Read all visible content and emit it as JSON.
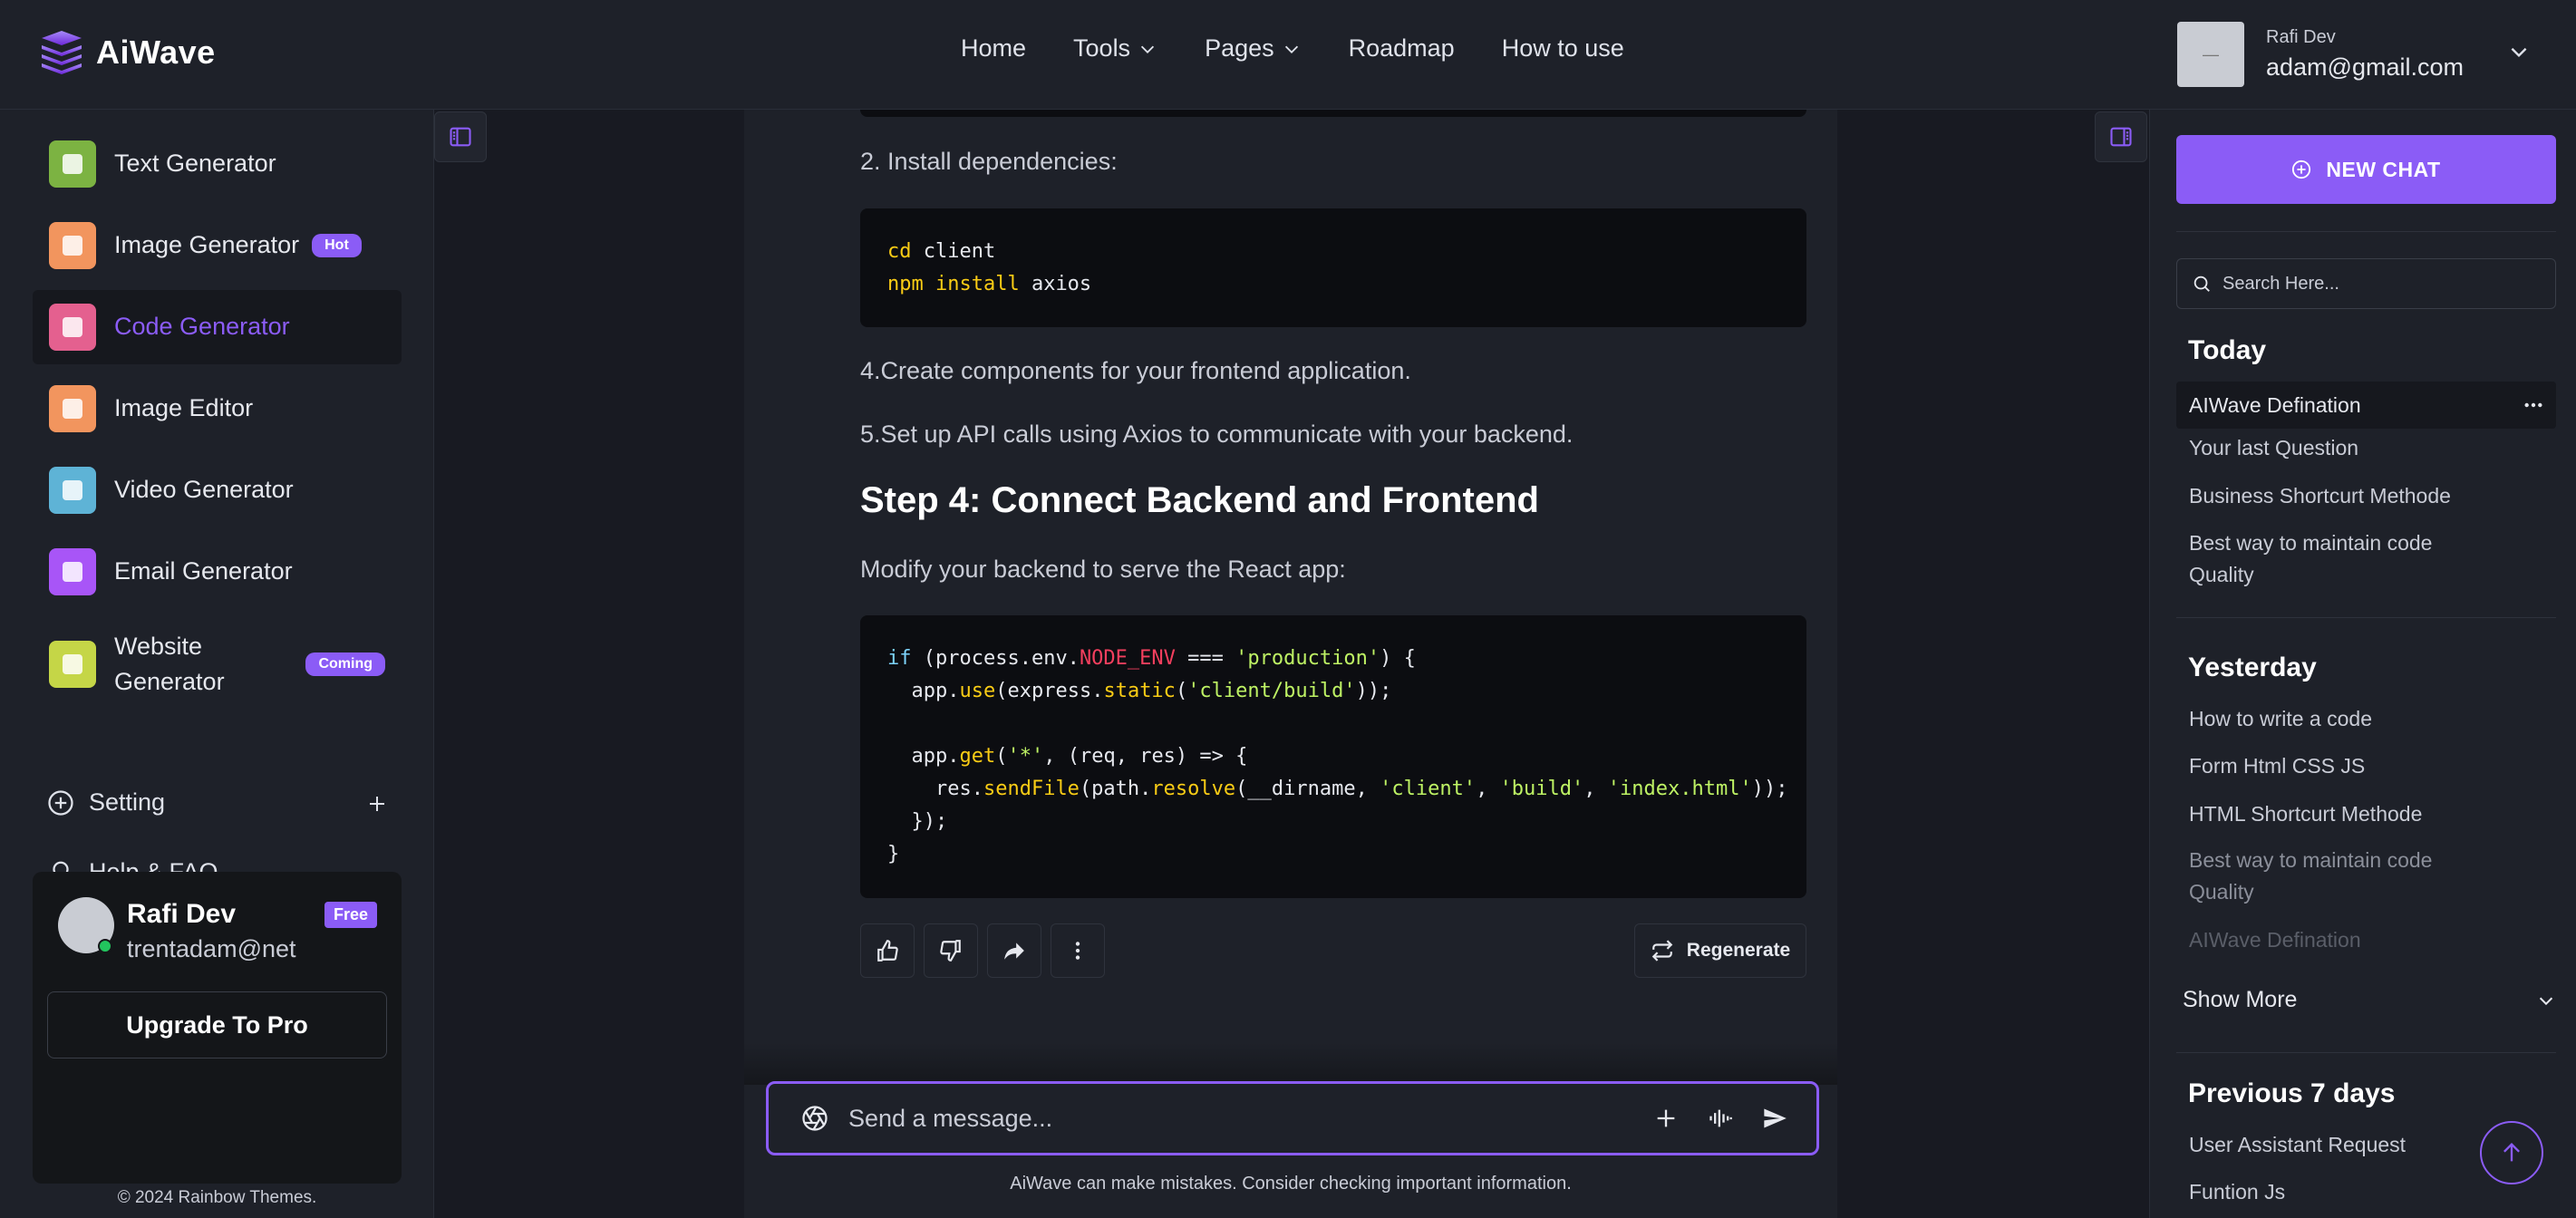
{
  "app": {
    "name": "AiWave"
  },
  "nav": {
    "items": [
      {
        "label": "Home",
        "has_dropdown": false
      },
      {
        "label": "Tools",
        "has_dropdown": true
      },
      {
        "label": "Pages",
        "has_dropdown": true
      },
      {
        "label": "Roadmap",
        "has_dropdown": false
      },
      {
        "label": "How to use",
        "has_dropdown": false
      }
    ]
  },
  "user": {
    "name": "Rafi Dev",
    "email": "adam@gmail.com",
    "avatar_text": "—"
  },
  "sidebar": {
    "items": [
      {
        "label": "Text Generator",
        "icon": "text-doc-icon",
        "color": "#7cb342"
      },
      {
        "label": "Image Generator",
        "icon": "image-icon",
        "color": "#f2955e",
        "badge": "Hot"
      },
      {
        "label": "Code Generator",
        "icon": "code-icon",
        "color": "#e4608f",
        "active": true
      },
      {
        "label": "Image Editor",
        "icon": "image-edit-icon",
        "color": "#f2955e"
      },
      {
        "label": "Video Generator",
        "icon": "video-icon",
        "color": "#5eb3d6"
      },
      {
        "label": "Email Generator",
        "icon": "email-icon",
        "color": "#a855f7"
      },
      {
        "label": "Website Generator",
        "icon": "website-icon",
        "color": "#c5d647",
        "badge": "Coming"
      }
    ],
    "setting_label": "Setting",
    "help_label": "Help & FAQ"
  },
  "profile_card": {
    "name": "Rafi Dev",
    "email": "trentadam@net",
    "plan": "Free",
    "upgrade_label": "Upgrade To Pro"
  },
  "copyright": "© 2024 Rainbow Themes.",
  "chat": {
    "step_install": "2. Install dependencies:",
    "code1": [
      [
        {
          "t": "cd",
          "c": "yl"
        },
        {
          "t": " client",
          "c": ""
        }
      ],
      [
        {
          "t": "npm install",
          "c": "yl"
        },
        {
          "t": " axios",
          "c": ""
        }
      ]
    ],
    "step_components": "4.Create components for your frontend application.",
    "step_api": "5.Set up API calls using Axios to communicate with your backend.",
    "heading": "Step 4: Connect Backend and Frontend",
    "modify_text": "Modify your backend to serve the React app:",
    "code2": [
      [
        {
          "t": "if",
          "c": "kw"
        },
        {
          "t": " (process.env.",
          "c": ""
        },
        {
          "t": "NODE_ENV",
          "c": "env"
        },
        {
          "t": " === ",
          "c": ""
        },
        {
          "t": "'production'",
          "c": "str"
        },
        {
          "t": ") {",
          "c": ""
        }
      ],
      [
        {
          "t": "  app.",
          "c": ""
        },
        {
          "t": "use",
          "c": "fn"
        },
        {
          "t": "(express.",
          "c": ""
        },
        {
          "t": "static",
          "c": "fn"
        },
        {
          "t": "(",
          "c": ""
        },
        {
          "t": "'client/build'",
          "c": "str"
        },
        {
          "t": "));",
          "c": ""
        }
      ],
      [
        {
          "t": "",
          "c": ""
        }
      ],
      [
        {
          "t": "  app.",
          "c": ""
        },
        {
          "t": "get",
          "c": "fn"
        },
        {
          "t": "(",
          "c": ""
        },
        {
          "t": "'*'",
          "c": "str"
        },
        {
          "t": ", (req, res) => {",
          "c": ""
        }
      ],
      [
        {
          "t": "    res.",
          "c": ""
        },
        {
          "t": "sendFile",
          "c": "fn"
        },
        {
          "t": "(path.",
          "c": ""
        },
        {
          "t": "resolve",
          "c": "fn"
        },
        {
          "t": "(__dirname, ",
          "c": ""
        },
        {
          "t": "'client'",
          "c": "str"
        },
        {
          "t": ", ",
          "c": ""
        },
        {
          "t": "'build'",
          "c": "str"
        },
        {
          "t": ", ",
          "c": ""
        },
        {
          "t": "'index.html'",
          "c": "str"
        },
        {
          "t": "));",
          "c": ""
        }
      ],
      [
        {
          "t": "  });",
          "c": ""
        }
      ],
      [
        {
          "t": "}",
          "c": ""
        }
      ]
    ],
    "regenerate_label": "Regenerate",
    "input_placeholder": "Send a message...",
    "disclaimer": "AiWave can make mistakes. Consider checking important information."
  },
  "right_panel": {
    "new_chat_label": "NEW CHAT",
    "search_placeholder": "Search Here...",
    "today_title": "Today",
    "today": [
      "AIWave Defination",
      "Your last Question",
      "Business Shortcurt Methode",
      "Best way to maintain code Quality"
    ],
    "yesterday_title": "Yesterday",
    "yesterday": [
      "How to write a code",
      "Form Html CSS JS",
      "HTML Shortcurt Methode",
      "Best way to maintain code Quality",
      "AIWave Defination"
    ],
    "show_more_label": "Show More",
    "prev7_title": "Previous 7 days",
    "prev7": [
      "User Assistant Request",
      "Funtion Js"
    ]
  },
  "colors": {
    "accent": "#8b5cf6",
    "background": "#181a22",
    "panel": "#1e2129",
    "code_bg": "#0c0d11"
  }
}
